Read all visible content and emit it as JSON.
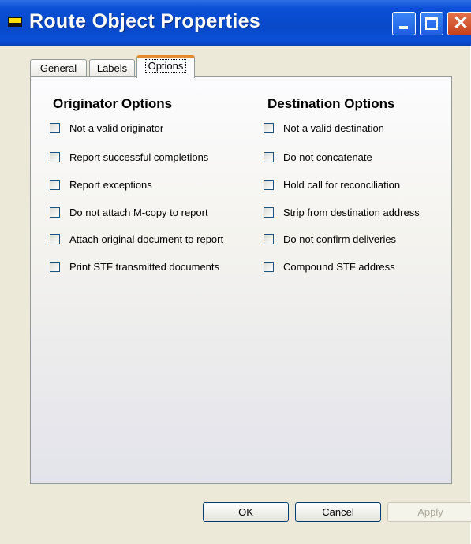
{
  "window": {
    "title": "Route Object Properties"
  },
  "tabs": [
    {
      "label": "General"
    },
    {
      "label": "Labels"
    },
    {
      "label": "Options",
      "selected": true
    }
  ],
  "originator": {
    "heading": "Originator Options",
    "options": [
      {
        "label": "Not a valid originator",
        "checked": false
      },
      {
        "label": "Report successful completions",
        "checked": false
      },
      {
        "label": "Report exceptions",
        "checked": false
      },
      {
        "label": "Do not attach M-copy to report",
        "checked": false
      },
      {
        "label": "Attach original document to report",
        "checked": false
      },
      {
        "label": "Print STF transmitted documents",
        "checked": false
      }
    ]
  },
  "destination": {
    "heading": "Destination Options",
    "options": [
      {
        "label": "Not a valid destination",
        "checked": false
      },
      {
        "label": "Do not concatenate",
        "checked": false
      },
      {
        "label": "Hold call for reconciliation",
        "checked": false
      },
      {
        "label": "Strip from destination address",
        "checked": false
      },
      {
        "label": "Do not confirm deliveries",
        "checked": false
      },
      {
        "label": "Compound STF address",
        "checked": false
      }
    ]
  },
  "buttons": {
    "ok": "OK",
    "cancel": "Cancel",
    "apply": "Apply",
    "apply_enabled": false
  },
  "colors": {
    "titlebar": "#0a4fd6",
    "tab_highlight": "#e68b2c",
    "dialog_bg": "#ece9d8"
  }
}
